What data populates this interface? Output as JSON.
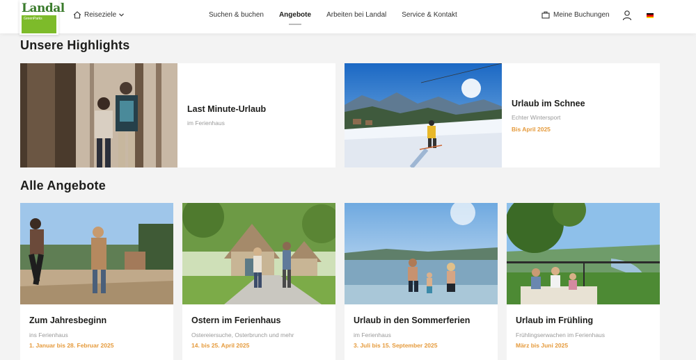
{
  "header": {
    "logo_text": "Landal",
    "logo_sub": "GreenParks",
    "destinations_label": "Reiseziele",
    "nav": [
      {
        "label": "Suchen & buchen"
      },
      {
        "label": "Angebote"
      },
      {
        "label": "Arbeiten bei Landal"
      },
      {
        "label": "Service & Kontakt"
      }
    ],
    "active_nav": "Angebote",
    "bookings_label": "Meine Buchungen",
    "icons": [
      "suitcase-icon",
      "user-icon",
      "german-flag-icon"
    ]
  },
  "highlights": {
    "title": "Unsere Highlights",
    "items": [
      {
        "title": "Last Minute-Urlaub",
        "subtitle": "im Ferienhaus",
        "date": ""
      },
      {
        "title": "Urlaub im Schnee",
        "subtitle": "Echter Wintersport",
        "date": "Bis April 2025"
      }
    ]
  },
  "offers": {
    "title": "Alle Angebote",
    "items": [
      {
        "title": "Zum Jahresbeginn",
        "subtitle": "ins Ferienhaus",
        "date": "1. Januar bis 28. Februar 2025"
      },
      {
        "title": "Ostern im Ferienhaus",
        "subtitle": "Ostereiersuche, Osterbrunch und mehr",
        "date": "14. bis 25. April 2025"
      },
      {
        "title": "Urlaub in den Sommerferien",
        "subtitle": "im Ferienhaus",
        "date": "3. Juli bis 15. September 2025"
      },
      {
        "title": "Urlaub im Frühling",
        "subtitle": "Frühlingserwachen im Ferienhaus",
        "date": "März bis Juni 2025"
      }
    ]
  },
  "colors": {
    "accent_date": "#e59a3b",
    "logo_green": "#7dbb2a",
    "background": "#f3f3f3"
  }
}
